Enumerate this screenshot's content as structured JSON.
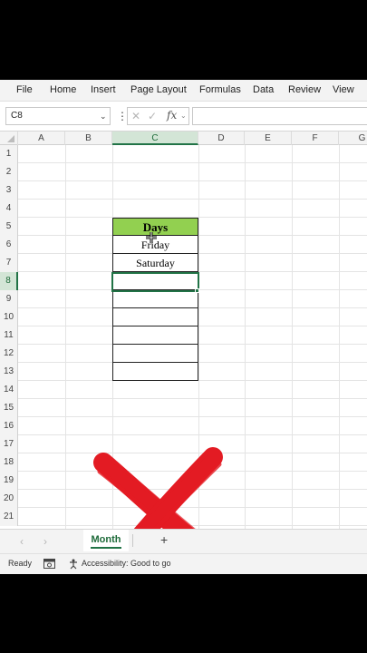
{
  "ribbon": {
    "tabs": [
      "File",
      "Home",
      "Insert",
      "Page Layout",
      "Formulas",
      "Data",
      "Review",
      "View"
    ]
  },
  "formula_bar": {
    "name_box": "C8",
    "formula_value": ""
  },
  "columns": [
    "A",
    "B",
    "C",
    "D",
    "E",
    "F",
    "G"
  ],
  "selected_column": "C",
  "rows": [
    "1",
    "2",
    "3",
    "4",
    "5",
    "6",
    "7",
    "8",
    "9",
    "10",
    "11",
    "12",
    "13",
    "14",
    "15",
    "16",
    "17",
    "18",
    "19",
    "20",
    "21"
  ],
  "selected_row": "8",
  "cells": {
    "c5": "Days",
    "c6": "Friday",
    "c7": "Saturday",
    "c8": "",
    "c9": "",
    "c10": "",
    "c11": "",
    "c12": "",
    "c13": ""
  },
  "sheets": {
    "active": "Month"
  },
  "status": {
    "ready": "Ready",
    "accessibility": "Accessibility: Good to go"
  },
  "colors": {
    "header_fill": "#92d050",
    "excel_green": "#217346",
    "red_mark": "#e31b23"
  },
  "icons": {
    "cancel": "close-icon",
    "enter": "check-icon",
    "function": "fx-icon",
    "red_mark": "red-x-mark"
  }
}
